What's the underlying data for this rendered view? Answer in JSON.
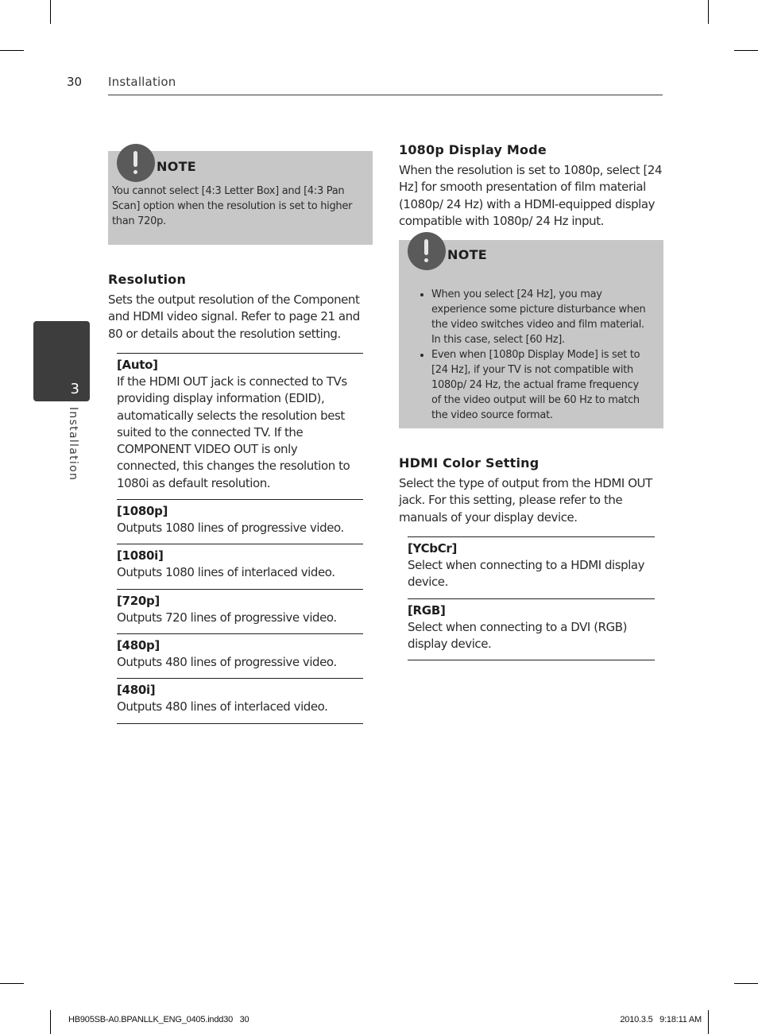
{
  "header": {
    "page_number": "30",
    "running_head": "Installation"
  },
  "side_tab": {
    "chapter_number": "3",
    "label": "Installation"
  },
  "left_column": {
    "note": {
      "title": "NOTE",
      "icon": "exclamation-icon",
      "text": "You cannot select [4:3 Letter Box] and [4:3 Pan Scan] option when the resolution is set to higher than 720p."
    },
    "resolution": {
      "heading": "Resolution",
      "intro": "Sets the output resolution of the Component and HDMI video signal. Refer to page 21 and 80 or details about the resolution setting.",
      "options": [
        {
          "label": "[Auto]",
          "description": "If the HDMI OUT jack is connected to TVs providing display information (EDID), automatically selects the resolution best suited to the connected TV. If the COMPONENT VIDEO OUT is only connected, this changes the resolution to 1080i as default resolution."
        },
        {
          "label": "[1080p]",
          "description": "Outputs 1080 lines of progressive video."
        },
        {
          "label": "[1080i]",
          "description": "Outputs 1080 lines of interlaced video."
        },
        {
          "label": "[720p]",
          "description": "Outputs 720 lines of progressive video."
        },
        {
          "label": "[480p]",
          "description": "Outputs 480 lines of progressive video."
        },
        {
          "label": "[480i]",
          "description": "Outputs 480 lines of interlaced video."
        }
      ]
    }
  },
  "right_column": {
    "display_mode": {
      "heading": "1080p Display Mode",
      "intro": "When the resolution is set to 1080p, select [24 Hz] for smooth presentation of film material (1080p/ 24 Hz) with a HDMI-equipped display compatible with 1080p/ 24 Hz input."
    },
    "note": {
      "title": "NOTE",
      "icon": "exclamation-icon",
      "bullets": [
        "When you select [24 Hz], you may experience some picture disturbance when the video switches video and film material. In this case, select [60 Hz].",
        "Even when [1080p Display Mode] is set to [24 Hz], if your TV is not compatible with 1080p/ 24 Hz, the actual frame frequency of the video output will be 60 Hz to match the video source format."
      ]
    },
    "hdmi_color": {
      "heading": "HDMI Color Setting",
      "intro": "Select the type of output from the HDMI OUT jack. For this setting, please refer to the manuals of your display device.",
      "options": [
        {
          "label": "[YCbCr]",
          "description": "Select when connecting to a HDMI display device."
        },
        {
          "label": "[RGB]",
          "description": "Select when connecting to a DVI (RGB) display device."
        }
      ]
    }
  },
  "footer": {
    "file_slug": "HB905SB-A0.BPANLLK_ENG_0405.indd30   30",
    "timestamp": "2010.3.5   9:18:11 AM"
  }
}
